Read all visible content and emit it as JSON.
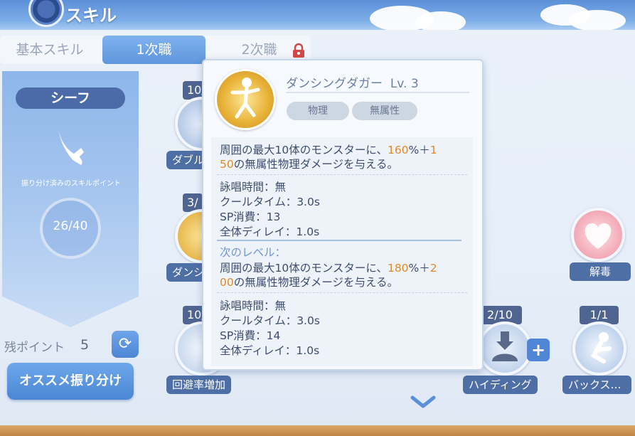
{
  "header": {
    "title": "スキル"
  },
  "tabs": [
    {
      "label": "基本スキル",
      "active": false
    },
    {
      "label": "1次職",
      "active": true
    },
    {
      "label": "2次職",
      "active": false,
      "locked": true
    }
  ],
  "job": {
    "name": "シーフ",
    "sp_caption": "振り分け済みのスキルポイント",
    "sp_used": "26/40"
  },
  "remaining": {
    "label": "残ポイント",
    "value": "5"
  },
  "recommend_label": "オススメ振り分け",
  "skills": [
    {
      "level": "10/",
      "label": "ダブル"
    },
    {
      "level": "3/",
      "label": "ダンシ"
    },
    {
      "level": "10/",
      "label": "回避率増加"
    },
    {
      "level": "",
      "label": "解毒"
    },
    {
      "level": "2/10",
      "label": "ハイディング"
    },
    {
      "level": "1/1",
      "label": "バックス…"
    }
  ],
  "tooltip": {
    "name": "ダンシングダガー",
    "level": "Lv. 3",
    "tags": [
      "物理",
      "無属性"
    ],
    "current": {
      "desc1_a": "周囲の最大10体のモンスターに、",
      "desc1_pct": "160",
      "desc1_b": "%＋",
      "desc1_add1": "1",
      "desc2_add2": "50",
      "desc2_b": "の無属性物理ダメージを与える。",
      "cast": "詠唱時間：無",
      "cooldown": "クールタイム：3.0s",
      "sp": "SP消費：13",
      "delay": "全体ディレイ：1.0s"
    },
    "next_label": "次のレベル：",
    "next": {
      "desc1_a": "周囲の最大10体のモンスターに、",
      "desc1_pct": "180",
      "desc1_b": "%＋",
      "desc1_add1": "2",
      "desc2_add2": "00",
      "desc2_b": "の無属性物理ダメージを与える。",
      "cast": "詠唱時間：無",
      "cooldown": "クールタイム：3.0s",
      "sp": "SP消費：14",
      "delay": "全体ディレイ：1.0s"
    }
  },
  "colors": {
    "accent": "#5f96dd",
    "highlight": "#e08a2a",
    "label_bg": "#4e6ea6"
  }
}
